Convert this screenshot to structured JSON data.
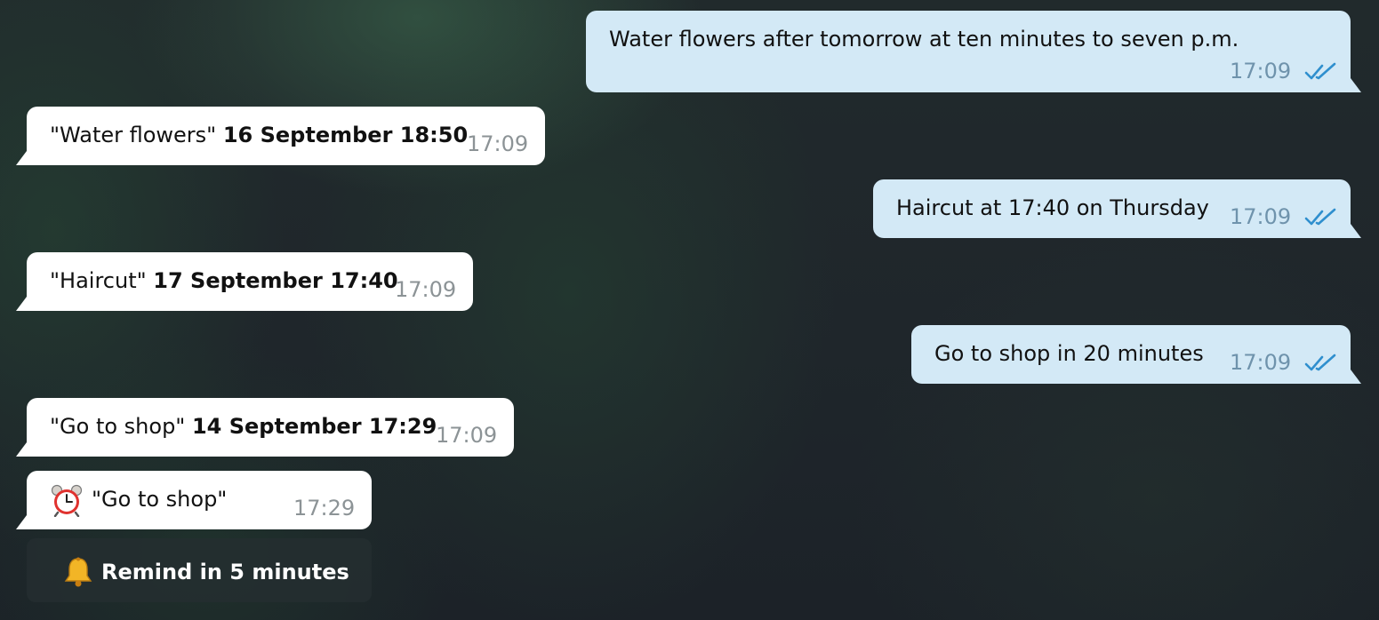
{
  "messages": [
    {
      "direction": "outgoing",
      "text": "Water flowers after tomorrow at ten minutes to seven p.m.",
      "time": "17:09",
      "status_icon": "double-check-icon"
    },
    {
      "direction": "incoming",
      "text_plain": "\"Water flowers\"",
      "text_bold": "16 September 18:50",
      "time": "17:09"
    },
    {
      "direction": "outgoing",
      "text": "Haircut at 17:40 on Thursday",
      "time": "17:09",
      "status_icon": "double-check-icon"
    },
    {
      "direction": "incoming",
      "text_plain": "\"Haircut\"",
      "text_bold": "17 September 17:40",
      "time": "17:09"
    },
    {
      "direction": "outgoing",
      "text": "Go to shop in 20 minutes",
      "time": "17:09",
      "status_icon": "double-check-icon"
    },
    {
      "direction": "incoming",
      "text_plain": "\"Go to shop\"",
      "text_bold": "14 September 17:29",
      "time": "17:09"
    },
    {
      "direction": "incoming",
      "icon": "alarm-clock-icon",
      "text_plain": "\"Go to shop\"",
      "time": "17:29"
    }
  ],
  "inline_button": {
    "icon": "bell-icon",
    "label": "Remind in 5 minutes"
  },
  "colors": {
    "outgoing_bubble": "#d3e9f6",
    "incoming_bubble": "#ffffff",
    "tick_color": "#2f8fce",
    "button_background": "#242e30"
  }
}
